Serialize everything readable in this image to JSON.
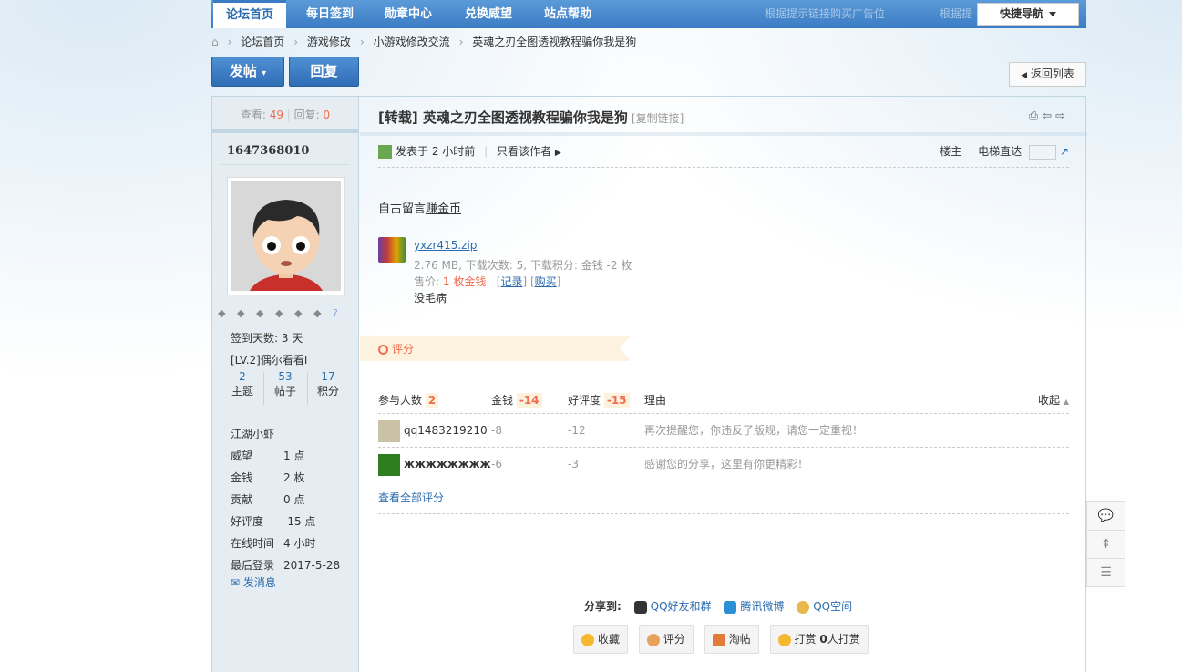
{
  "nav": {
    "tabs": [
      "论坛首页",
      "每日签到",
      "勋章中心",
      "兑换威望",
      "站点帮助"
    ],
    "ads": [
      "根据提示链接购买广告位",
      "根据提示链接购买广告位"
    ],
    "quicknav": "快捷导航"
  },
  "breadcrumb": [
    "论坛首页",
    "游戏修改",
    "小游戏修改交流",
    "英魂之刃全图透视教程骗你我是狗"
  ],
  "buttons": {
    "post": "发帖",
    "reply": "回复",
    "back": "返回列表"
  },
  "stats": {
    "views_label": "查看:",
    "views": "49",
    "replies_label": "回复:",
    "replies": "0"
  },
  "user": {
    "name": "1647368010",
    "checkin": "签到天数: 3 天",
    "level": "[LV.2]偶尔看看I",
    "counts": [
      {
        "value": "2",
        "label": "主题"
      },
      {
        "value": "53",
        "label": "帖子"
      },
      {
        "value": "17",
        "label": "积分"
      }
    ],
    "group": "江湖小虾",
    "info": [
      {
        "k": "威望",
        "v": "1 点"
      },
      {
        "k": "金钱",
        "v": "2 枚"
      },
      {
        "k": "贡献",
        "v": "0 点"
      },
      {
        "k": "好评度",
        "v": "-15 点"
      },
      {
        "k": "在线时间",
        "v": "4 小时"
      },
      {
        "k": "最后登录",
        "v": "2017-5-28"
      }
    ],
    "send_msg": "发消息"
  },
  "post": {
    "title": "[转载] 英魂之刃全图透视教程骗你我是狗",
    "copy_link": "[复制链接]",
    "posted": "发表于 2 小时前",
    "only_author": "只看该作者",
    "floor": "楼主",
    "elevator": "电梯直达",
    "content_prefix": "自古留言",
    "content_link": "赚金币",
    "attachment": {
      "name": "yxzr415.zip",
      "meta": "2.76 MB, 下载次数: 5, 下载积分: 金钱 -2 枚",
      "price_label": "售价:",
      "price": "1 枚金钱",
      "record": "记录",
      "buy": "购买",
      "note": "没毛病"
    }
  },
  "rating": {
    "tag": "评分",
    "headers": {
      "participants": "参与人数",
      "participants_n": "2",
      "money": "金钱",
      "money_n": "-14",
      "rep": "好评度",
      "rep_n": "-15",
      "reason": "理由",
      "collapse": "收起"
    },
    "rows": [
      {
        "user": "qq1483219210",
        "money": "-8",
        "rep": "-12",
        "reason": "再次提醒您，你违反了版规，请您一定重视！"
      },
      {
        "user": "жжжжжжжж",
        "money": "-6",
        "rep": "-3",
        "reason": "感谢您的分享，这里有你更精彩！"
      }
    ],
    "view_all": "查看全部评分"
  },
  "share": {
    "label": "分享到:",
    "items": [
      "QQ好友和群",
      "腾讯微博",
      "QQ空间"
    ]
  },
  "actions": {
    "fav": "收藏",
    "rate": "评分",
    "tao": "淘帖",
    "tip": "打赏",
    "tip_count": "0",
    "tip_suffix": "人打赏"
  },
  "colors": {
    "accent": "#2b6cb0",
    "side_bg": "#e5edf2",
    "highlight": "#f26c4f"
  }
}
